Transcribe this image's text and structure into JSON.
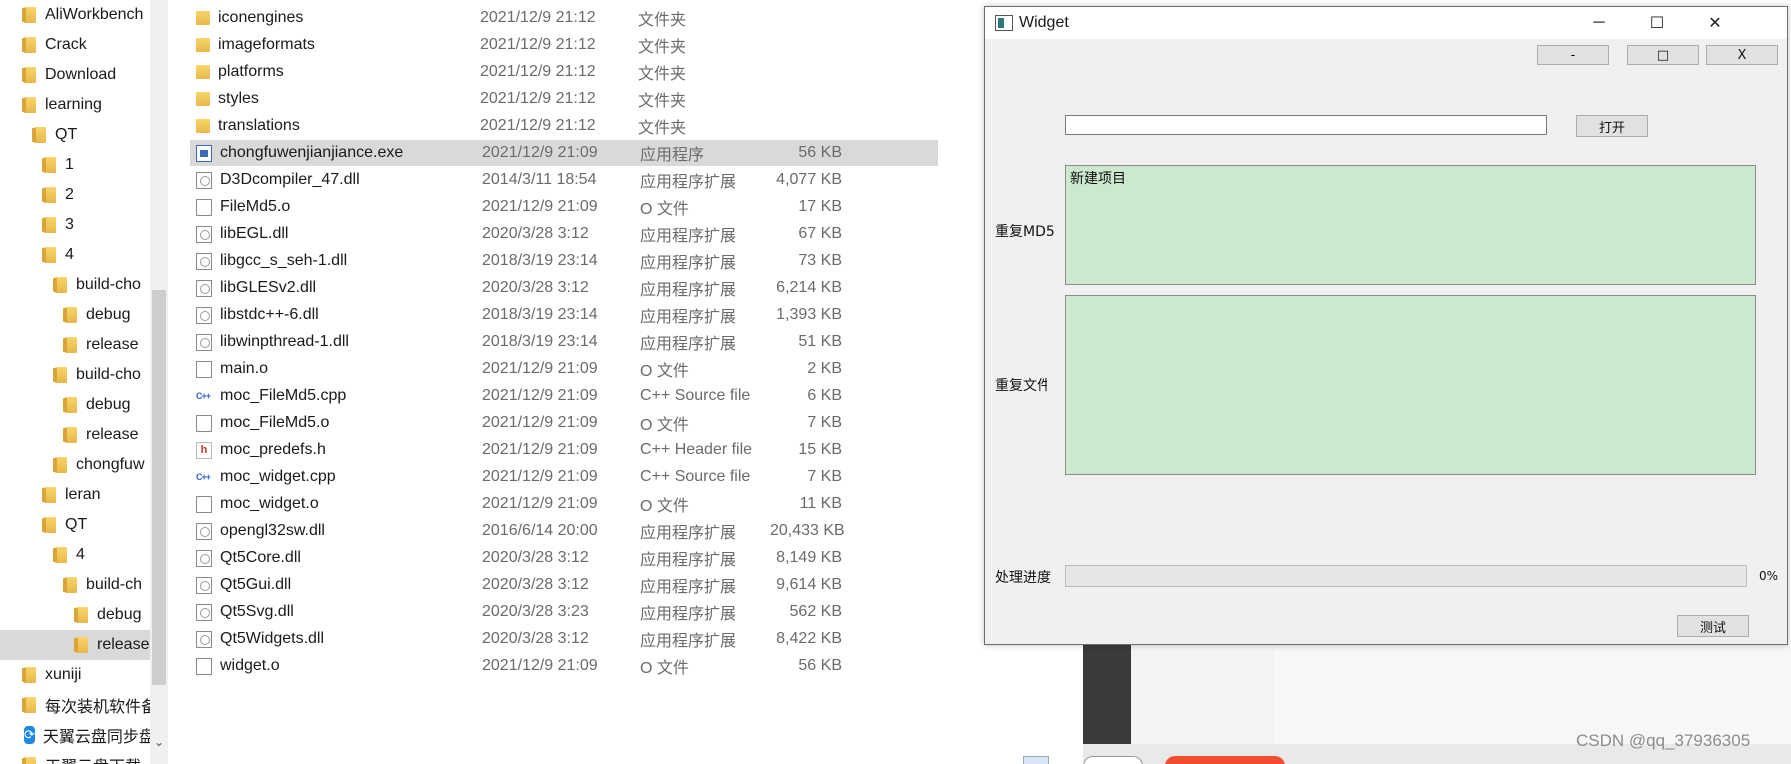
{
  "nav": {
    "items": [
      {
        "label": "AliWorkbench",
        "indent": 0
      },
      {
        "label": "Crack",
        "indent": 0
      },
      {
        "label": "Download",
        "indent": 0
      },
      {
        "label": "learning",
        "indent": 0
      },
      {
        "label": "QT",
        "indent": 1
      },
      {
        "label": "1",
        "indent": 2
      },
      {
        "label": "2",
        "indent": 2
      },
      {
        "label": "3",
        "indent": 2
      },
      {
        "label": "4",
        "indent": 2
      },
      {
        "label": "build-cho",
        "indent": 3
      },
      {
        "label": "debug",
        "indent": 4
      },
      {
        "label": "release",
        "indent": 4
      },
      {
        "label": "build-cho",
        "indent": 3
      },
      {
        "label": "debug",
        "indent": 4
      },
      {
        "label": "release",
        "indent": 4
      },
      {
        "label": "chongfuw",
        "indent": 3
      },
      {
        "label": "leran",
        "indent": 2
      },
      {
        "label": "QT",
        "indent": 2
      },
      {
        "label": "4",
        "indent": 3
      },
      {
        "label": "build-ch",
        "indent": 4
      },
      {
        "label": "debug",
        "indent": 5
      },
      {
        "label": "release",
        "indent": 5,
        "selected": true
      },
      {
        "label": "xuniji",
        "indent": 0
      },
      {
        "label": "每次装机软件备",
        "indent": 0
      },
      {
        "label": "天翼云盘同步盘",
        "indent": 0,
        "icon": "sync-icon"
      },
      {
        "label": "天翼云盘下载",
        "indent": 0
      }
    ],
    "scroll_arrow": "⌄"
  },
  "files": [
    {
      "name": "iconengines",
      "date": "2021/12/9 21:12",
      "type": "文件夹",
      "size": "",
      "icon": "folder"
    },
    {
      "name": "imageformats",
      "date": "2021/12/9 21:12",
      "type": "文件夹",
      "size": "",
      "icon": "folder"
    },
    {
      "name": "platforms",
      "date": "2021/12/9 21:12",
      "type": "文件夹",
      "size": "",
      "icon": "folder"
    },
    {
      "name": "styles",
      "date": "2021/12/9 21:12",
      "type": "文件夹",
      "size": "",
      "icon": "folder"
    },
    {
      "name": "translations",
      "date": "2021/12/9 21:12",
      "type": "文件夹",
      "size": "",
      "icon": "folder"
    },
    {
      "name": "chongfuwenjianjiance.exe",
      "date": "2021/12/9 21:09",
      "type": "应用程序",
      "size": "56 KB",
      "icon": "exe",
      "selected": true
    },
    {
      "name": "D3Dcompiler_47.dll",
      "date": "2014/3/11 18:54",
      "type": "应用程序扩展",
      "size": "4,077 KB",
      "icon": "dll"
    },
    {
      "name": "FileMd5.o",
      "date": "2021/12/9 21:09",
      "type": "O 文件",
      "size": "17 KB",
      "icon": "doc"
    },
    {
      "name": "libEGL.dll",
      "date": "2020/3/28 3:12",
      "type": "应用程序扩展",
      "size": "67 KB",
      "icon": "dll"
    },
    {
      "name": "libgcc_s_seh-1.dll",
      "date": "2018/3/19 23:14",
      "type": "应用程序扩展",
      "size": "73 KB",
      "icon": "dll"
    },
    {
      "name": "libGLESv2.dll",
      "date": "2020/3/28 3:12",
      "type": "应用程序扩展",
      "size": "6,214 KB",
      "icon": "dll"
    },
    {
      "name": "libstdc++-6.dll",
      "date": "2018/3/19 23:14",
      "type": "应用程序扩展",
      "size": "1,393 KB",
      "icon": "dll"
    },
    {
      "name": "libwinpthread-1.dll",
      "date": "2018/3/19 23:14",
      "type": "应用程序扩展",
      "size": "51 KB",
      "icon": "dll"
    },
    {
      "name": "main.o",
      "date": "2021/12/9 21:09",
      "type": "O 文件",
      "size": "2 KB",
      "icon": "doc"
    },
    {
      "name": "moc_FileMd5.cpp",
      "date": "2021/12/9 21:09",
      "type": "C++ Source file",
      "size": "6 KB",
      "icon": "cpp"
    },
    {
      "name": "moc_FileMd5.o",
      "date": "2021/12/9 21:09",
      "type": "O 文件",
      "size": "7 KB",
      "icon": "doc"
    },
    {
      "name": "moc_predefs.h",
      "date": "2021/12/9 21:09",
      "type": "C++ Header file",
      "size": "15 KB",
      "icon": "h"
    },
    {
      "name": "moc_widget.cpp",
      "date": "2021/12/9 21:09",
      "type": "C++ Source file",
      "size": "7 KB",
      "icon": "cpp"
    },
    {
      "name": "moc_widget.o",
      "date": "2021/12/9 21:09",
      "type": "O 文件",
      "size": "11 KB",
      "icon": "doc"
    },
    {
      "name": "opengl32sw.dll",
      "date": "2016/6/14 20:00",
      "type": "应用程序扩展",
      "size": "20,433 KB",
      "icon": "dll"
    },
    {
      "name": "Qt5Core.dll",
      "date": "2020/3/28 3:12",
      "type": "应用程序扩展",
      "size": "8,149 KB",
      "icon": "dll"
    },
    {
      "name": "Qt5Gui.dll",
      "date": "2020/3/28 3:12",
      "type": "应用程序扩展",
      "size": "9,614 KB",
      "icon": "dll"
    },
    {
      "name": "Qt5Svg.dll",
      "date": "2020/3/28 3:23",
      "type": "应用程序扩展",
      "size": "562 KB",
      "icon": "dll"
    },
    {
      "name": "Qt5Widgets.dll",
      "date": "2020/3/28 3:12",
      "type": "应用程序扩展",
      "size": "8,422 KB",
      "icon": "dll"
    },
    {
      "name": "widget.o",
      "date": "2021/12/9 21:09",
      "type": "O 文件",
      "size": "56 KB",
      "icon": "doc"
    }
  ],
  "icons": {
    "folder": "folder-icon",
    "exe": "exe-file-icon",
    "dll": "dll-file-icon",
    "doc": "object-file-icon",
    "cpp": "cpp-source-icon",
    "h": "header-file-icon"
  },
  "widget": {
    "title": "Widget",
    "caption_minimize": "─",
    "caption_maximize": "☐",
    "caption_close": "✕",
    "btn_min": "-",
    "btn_max": "□",
    "btn_close": "X",
    "path_value": "",
    "open_button": "打开",
    "md5_label": "重复MD5",
    "md5_list": [
      "新建项目"
    ],
    "file_label": "重复文件",
    "file_list": [],
    "progress_label": "处理进度",
    "progress_value": 0,
    "progress_text": "0%",
    "test_button": "测试"
  },
  "watermark": "CSDN @qq_37936305",
  "colors": {
    "list_bg": "#cce8cf",
    "selected_row": "#d9d9d9",
    "dialog_bg": "#f0f0f0"
  }
}
